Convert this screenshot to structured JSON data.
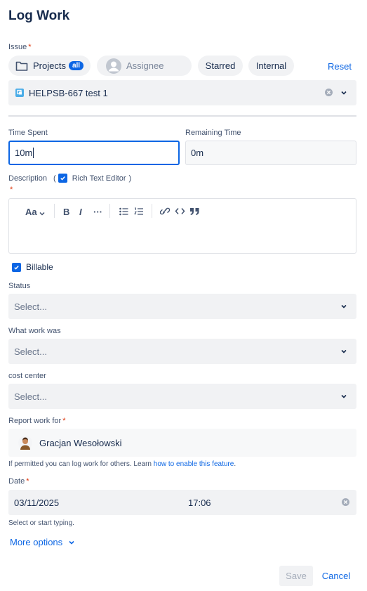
{
  "title": "Log Work",
  "issue": {
    "label": "Issue",
    "filters": {
      "projects_label": "Projects",
      "projects_badge": "all",
      "assignee_placeholder": "Assignee",
      "starred_label": "Starred",
      "internal_label": "Internal",
      "reset_label": "Reset"
    },
    "selected": "HELPSB-667 test 1"
  },
  "time_spent": {
    "label": "Time Spent",
    "value": "10m"
  },
  "remaining_time": {
    "label": "Remaining Time",
    "value": "0m"
  },
  "description": {
    "label": "Description",
    "rte_label": "Rich Text Editor",
    "rte_checked": true,
    "toolbar": {
      "text_style": "Aa",
      "bold": "B",
      "italic": "I",
      "more": "···"
    }
  },
  "billable": {
    "label": "Billable",
    "checked": true
  },
  "status": {
    "label": "Status",
    "placeholder": "Select..."
  },
  "what_work": {
    "label": "What work was",
    "placeholder": "Select..."
  },
  "cost_center": {
    "label": "cost center",
    "placeholder": "Select..."
  },
  "report_for": {
    "label": "Report work for",
    "user": "Gracjan Wesołowski",
    "hint_prefix": "If permitted you can log work for others. Learn ",
    "hint_link": "how to enable this feature",
    "hint_suffix": "."
  },
  "date": {
    "label": "Date",
    "date_value": "03/11/2025",
    "time_value": "17:06",
    "hint": "Select or start typing."
  },
  "more_options_label": "More options",
  "footer": {
    "save_label": "Save",
    "cancel_label": "Cancel"
  },
  "colors": {
    "accent": "#0c66e4",
    "field_bg": "#f1f2f4",
    "required": "#de350b"
  },
  "icons": [
    "folder-icon",
    "user-placeholder-icon",
    "issue-type-icon",
    "clear-icon",
    "chevron-down-icon",
    "checkbox-check-icon",
    "bullet-list-icon",
    "numbered-list-icon",
    "link-icon",
    "code-icon",
    "quote-icon"
  ]
}
